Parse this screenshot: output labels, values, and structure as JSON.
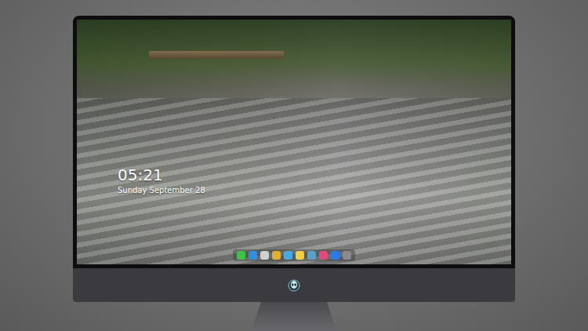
{
  "lock_screen": {
    "time": "05:21",
    "date": "Sunday September 28"
  },
  "dock": {
    "items": [
      {
        "color": "#3cc24a"
      },
      {
        "color": "#2f8fe0"
      },
      {
        "color": "#d0d0d0"
      },
      {
        "color": "#e0b030"
      },
      {
        "color": "#4aa8e0"
      },
      {
        "color": "#f0d040"
      },
      {
        "color": "#5fa0c0"
      },
      {
        "color": "#e04a80"
      },
      {
        "color": "#2a7be8"
      },
      {
        "color": "#8a8a90"
      }
    ]
  }
}
